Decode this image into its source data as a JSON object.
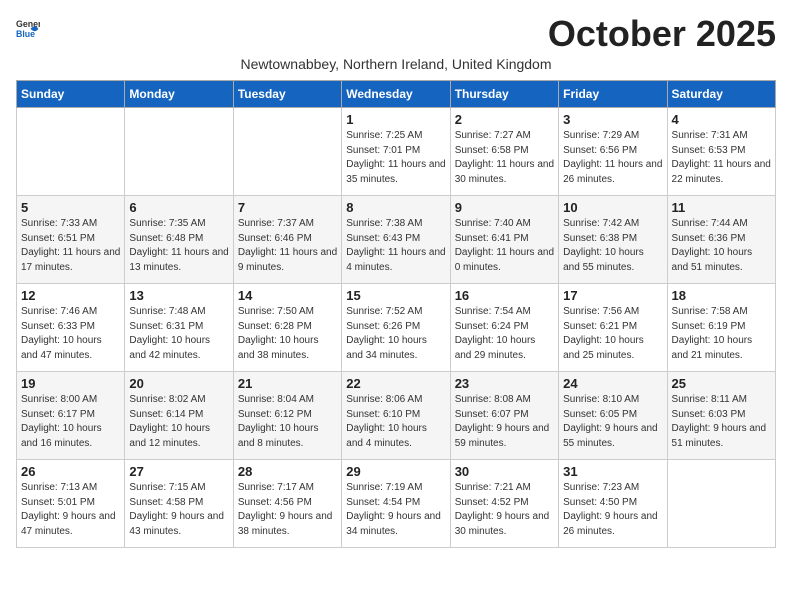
{
  "logo": {
    "general": "General",
    "blue": "Blue"
  },
  "title": "October 2025",
  "subtitle": "Newtownabbey, Northern Ireland, United Kingdom",
  "days_header": [
    "Sunday",
    "Monday",
    "Tuesday",
    "Wednesday",
    "Thursday",
    "Friday",
    "Saturday"
  ],
  "weeks": [
    [
      {
        "day": "",
        "sunrise": "",
        "sunset": "",
        "daylight": ""
      },
      {
        "day": "",
        "sunrise": "",
        "sunset": "",
        "daylight": ""
      },
      {
        "day": "",
        "sunrise": "",
        "sunset": "",
        "daylight": ""
      },
      {
        "day": "1",
        "sunrise": "Sunrise: 7:25 AM",
        "sunset": "Sunset: 7:01 PM",
        "daylight": "Daylight: 11 hours and 35 minutes."
      },
      {
        "day": "2",
        "sunrise": "Sunrise: 7:27 AM",
        "sunset": "Sunset: 6:58 PM",
        "daylight": "Daylight: 11 hours and 30 minutes."
      },
      {
        "day": "3",
        "sunrise": "Sunrise: 7:29 AM",
        "sunset": "Sunset: 6:56 PM",
        "daylight": "Daylight: 11 hours and 26 minutes."
      },
      {
        "day": "4",
        "sunrise": "Sunrise: 7:31 AM",
        "sunset": "Sunset: 6:53 PM",
        "daylight": "Daylight: 11 hours and 22 minutes."
      }
    ],
    [
      {
        "day": "5",
        "sunrise": "Sunrise: 7:33 AM",
        "sunset": "Sunset: 6:51 PM",
        "daylight": "Daylight: 11 hours and 17 minutes."
      },
      {
        "day": "6",
        "sunrise": "Sunrise: 7:35 AM",
        "sunset": "Sunset: 6:48 PM",
        "daylight": "Daylight: 11 hours and 13 minutes."
      },
      {
        "day": "7",
        "sunrise": "Sunrise: 7:37 AM",
        "sunset": "Sunset: 6:46 PM",
        "daylight": "Daylight: 11 hours and 9 minutes."
      },
      {
        "day": "8",
        "sunrise": "Sunrise: 7:38 AM",
        "sunset": "Sunset: 6:43 PM",
        "daylight": "Daylight: 11 hours and 4 minutes."
      },
      {
        "day": "9",
        "sunrise": "Sunrise: 7:40 AM",
        "sunset": "Sunset: 6:41 PM",
        "daylight": "Daylight: 11 hours and 0 minutes."
      },
      {
        "day": "10",
        "sunrise": "Sunrise: 7:42 AM",
        "sunset": "Sunset: 6:38 PM",
        "daylight": "Daylight: 10 hours and 55 minutes."
      },
      {
        "day": "11",
        "sunrise": "Sunrise: 7:44 AM",
        "sunset": "Sunset: 6:36 PM",
        "daylight": "Daylight: 10 hours and 51 minutes."
      }
    ],
    [
      {
        "day": "12",
        "sunrise": "Sunrise: 7:46 AM",
        "sunset": "Sunset: 6:33 PM",
        "daylight": "Daylight: 10 hours and 47 minutes."
      },
      {
        "day": "13",
        "sunrise": "Sunrise: 7:48 AM",
        "sunset": "Sunset: 6:31 PM",
        "daylight": "Daylight: 10 hours and 42 minutes."
      },
      {
        "day": "14",
        "sunrise": "Sunrise: 7:50 AM",
        "sunset": "Sunset: 6:28 PM",
        "daylight": "Daylight: 10 hours and 38 minutes."
      },
      {
        "day": "15",
        "sunrise": "Sunrise: 7:52 AM",
        "sunset": "Sunset: 6:26 PM",
        "daylight": "Daylight: 10 hours and 34 minutes."
      },
      {
        "day": "16",
        "sunrise": "Sunrise: 7:54 AM",
        "sunset": "Sunset: 6:24 PM",
        "daylight": "Daylight: 10 hours and 29 minutes."
      },
      {
        "day": "17",
        "sunrise": "Sunrise: 7:56 AM",
        "sunset": "Sunset: 6:21 PM",
        "daylight": "Daylight: 10 hours and 25 minutes."
      },
      {
        "day": "18",
        "sunrise": "Sunrise: 7:58 AM",
        "sunset": "Sunset: 6:19 PM",
        "daylight": "Daylight: 10 hours and 21 minutes."
      }
    ],
    [
      {
        "day": "19",
        "sunrise": "Sunrise: 8:00 AM",
        "sunset": "Sunset: 6:17 PM",
        "daylight": "Daylight: 10 hours and 16 minutes."
      },
      {
        "day": "20",
        "sunrise": "Sunrise: 8:02 AM",
        "sunset": "Sunset: 6:14 PM",
        "daylight": "Daylight: 10 hours and 12 minutes."
      },
      {
        "day": "21",
        "sunrise": "Sunrise: 8:04 AM",
        "sunset": "Sunset: 6:12 PM",
        "daylight": "Daylight: 10 hours and 8 minutes."
      },
      {
        "day": "22",
        "sunrise": "Sunrise: 8:06 AM",
        "sunset": "Sunset: 6:10 PM",
        "daylight": "Daylight: 10 hours and 4 minutes."
      },
      {
        "day": "23",
        "sunrise": "Sunrise: 8:08 AM",
        "sunset": "Sunset: 6:07 PM",
        "daylight": "Daylight: 9 hours and 59 minutes."
      },
      {
        "day": "24",
        "sunrise": "Sunrise: 8:10 AM",
        "sunset": "Sunset: 6:05 PM",
        "daylight": "Daylight: 9 hours and 55 minutes."
      },
      {
        "day": "25",
        "sunrise": "Sunrise: 8:11 AM",
        "sunset": "Sunset: 6:03 PM",
        "daylight": "Daylight: 9 hours and 51 minutes."
      }
    ],
    [
      {
        "day": "26",
        "sunrise": "Sunrise: 7:13 AM",
        "sunset": "Sunset: 5:01 PM",
        "daylight": "Daylight: 9 hours and 47 minutes."
      },
      {
        "day": "27",
        "sunrise": "Sunrise: 7:15 AM",
        "sunset": "Sunset: 4:58 PM",
        "daylight": "Daylight: 9 hours and 43 minutes."
      },
      {
        "day": "28",
        "sunrise": "Sunrise: 7:17 AM",
        "sunset": "Sunset: 4:56 PM",
        "daylight": "Daylight: 9 hours and 38 minutes."
      },
      {
        "day": "29",
        "sunrise": "Sunrise: 7:19 AM",
        "sunset": "Sunset: 4:54 PM",
        "daylight": "Daylight: 9 hours and 34 minutes."
      },
      {
        "day": "30",
        "sunrise": "Sunrise: 7:21 AM",
        "sunset": "Sunset: 4:52 PM",
        "daylight": "Daylight: 9 hours and 30 minutes."
      },
      {
        "day": "31",
        "sunrise": "Sunrise: 7:23 AM",
        "sunset": "Sunset: 4:50 PM",
        "daylight": "Daylight: 9 hours and 26 minutes."
      },
      {
        "day": "",
        "sunrise": "",
        "sunset": "",
        "daylight": ""
      }
    ]
  ]
}
